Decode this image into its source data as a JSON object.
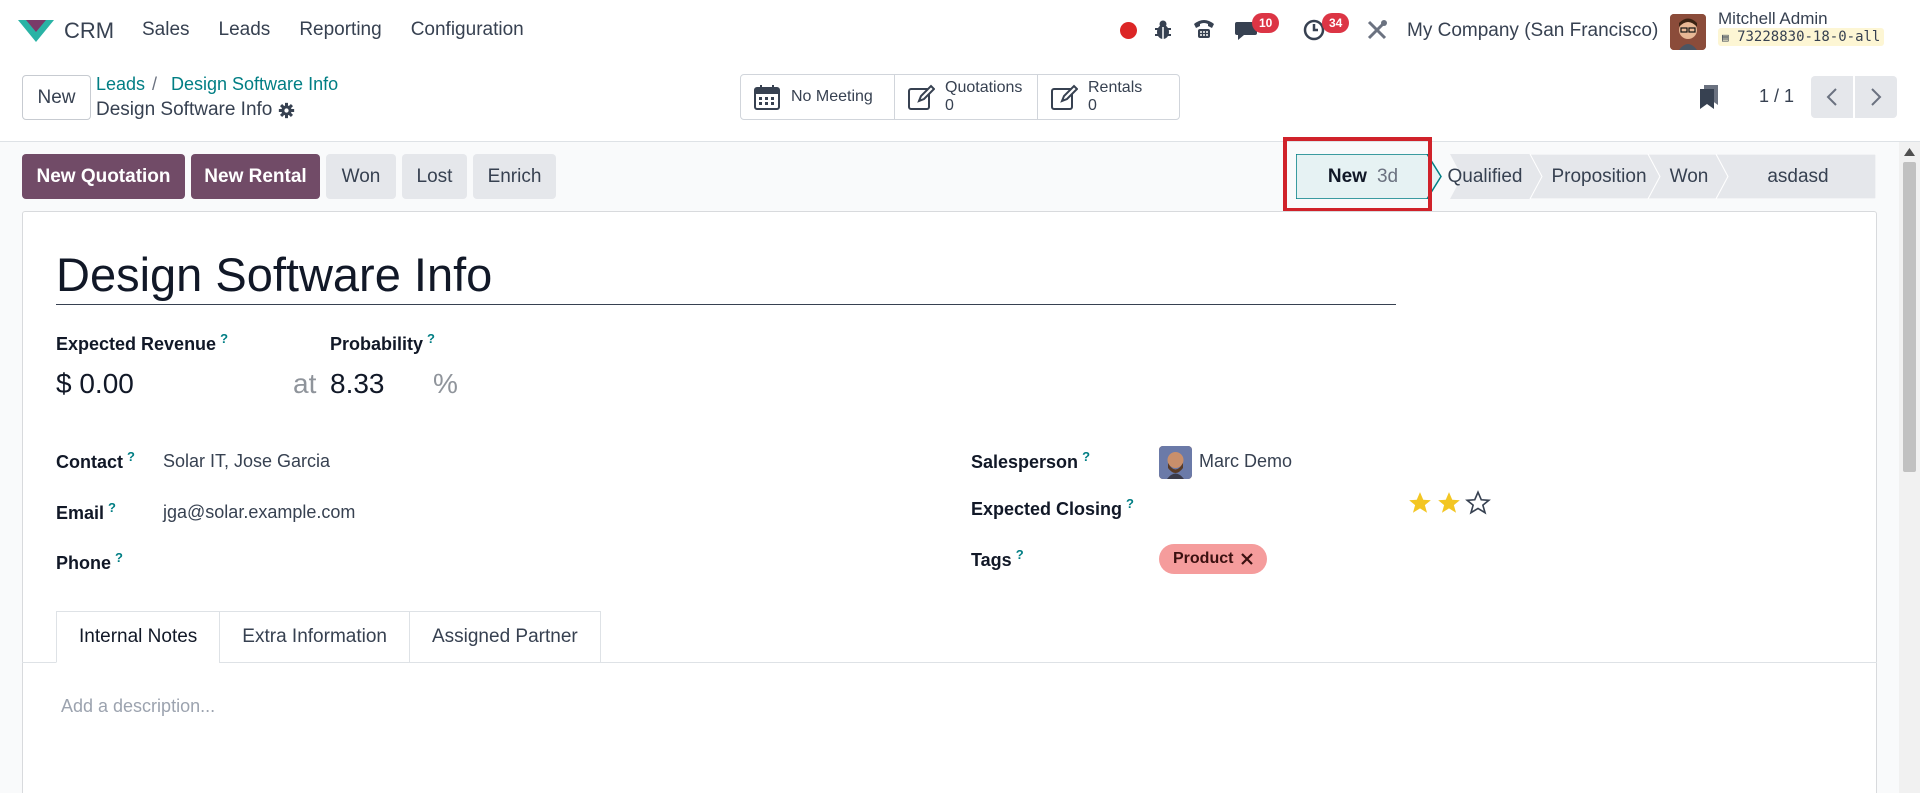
{
  "topnav": {
    "app_name": "CRM",
    "menu": [
      "Sales",
      "Leads",
      "Reporting",
      "Configuration"
    ],
    "chat_badge": "10",
    "activity_badge": "34",
    "company": "My Company (San Francisco)",
    "user_name": "Mitchell Admin",
    "db_name": "73228830-18-0-all"
  },
  "control": {
    "new_label": "New",
    "breadcrumb": [
      "Leads",
      "Design Software Info"
    ],
    "breadcrumb_sep": "/",
    "current_record": "Design Software Info",
    "smart_buttons": {
      "meeting": "No Meeting",
      "quotations_label": "Quotations",
      "quotations_count": "0",
      "rentals_label": "Rentals",
      "rentals_count": "0"
    },
    "pager": "1 / 1"
  },
  "actions": {
    "new_quotation": "New Quotation",
    "new_rental": "New Rental",
    "won": "Won",
    "lost": "Lost",
    "enrich": "Enrich"
  },
  "stages": {
    "current": "New",
    "current_duration": "3d",
    "others": [
      "Qualified",
      "Proposition",
      "Won",
      "asdasd"
    ]
  },
  "form": {
    "title": "Design Software Info",
    "expected_revenue_label": "Expected Revenue",
    "expected_revenue": "$ 0.00",
    "at_label": "at",
    "probability_label": "Probability",
    "probability": "8.33",
    "percent": "%",
    "help": "?",
    "contact_label": "Contact",
    "contact": "Solar IT, Jose Garcia",
    "email_label": "Email",
    "email": "jga@solar.example.com",
    "phone_label": "Phone",
    "phone": "",
    "salesperson_label": "Salesperson",
    "salesperson": "Marc Demo",
    "expected_closing_label": "Expected Closing",
    "priority_stars": 2,
    "priority_max": 3,
    "tags_label": "Tags",
    "tag": "Product"
  },
  "tabs": [
    "Internal Notes",
    "Extra Information",
    "Assigned Partner"
  ],
  "notes": {
    "placeholder": "Add a description..."
  },
  "colors": {
    "primary": "#714b67",
    "link": "#017e84",
    "badge": "#dc3545",
    "highlight": "#d0222a",
    "tag": "#f59c9c",
    "star": "#f3c623"
  }
}
